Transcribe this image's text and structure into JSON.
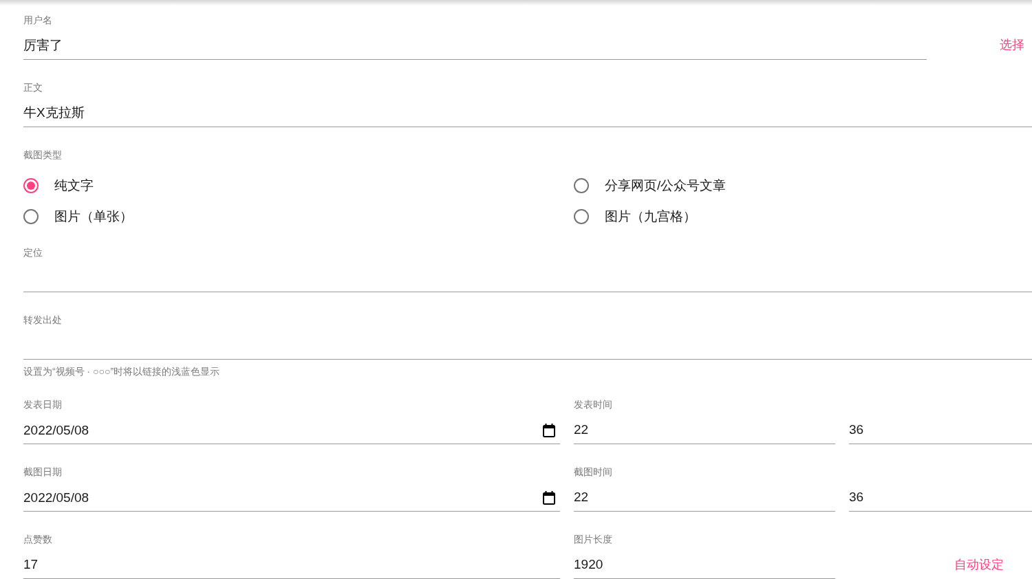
{
  "fields": [
    {
      "kind": "text",
      "label": "用户名",
      "value": "厉害了",
      "action": "选择"
    },
    {
      "kind": "text",
      "label": "正文",
      "value": "牛X克拉斯"
    },
    {
      "kind": "radio",
      "label": "截图类型",
      "options": [
        {
          "label": "纯文字",
          "selected": true
        },
        {
          "label": "分享网页/公众号文章",
          "selected": false
        },
        {
          "label": "图片（单张）",
          "selected": false
        },
        {
          "label": "图片（九宫格）",
          "selected": false
        }
      ]
    },
    {
      "kind": "text",
      "label": "定位"
    },
    {
      "kind": "text",
      "label": "转发出处",
      "helper": "设置为“视频号 · ○○○”时将以链接的浅蓝色显示"
    },
    {
      "kind": "datetime",
      "date": {
        "label": "发表日期",
        "value": "2022/05/08"
      },
      "time": {
        "label": "发表时间",
        "hour": "22",
        "minute": "36"
      }
    },
    {
      "kind": "datetime",
      "date": {
        "label": "截图日期",
        "value": "2022/05/08"
      },
      "time": {
        "label": "截图时间",
        "hour": "22",
        "minute": "36"
      }
    },
    {
      "kind": "pair",
      "left": {
        "label": "点赞数",
        "value": "17"
      },
      "right": {
        "label": "图片长度",
        "value": "1920",
        "action": "自动设定"
      }
    }
  ]
}
